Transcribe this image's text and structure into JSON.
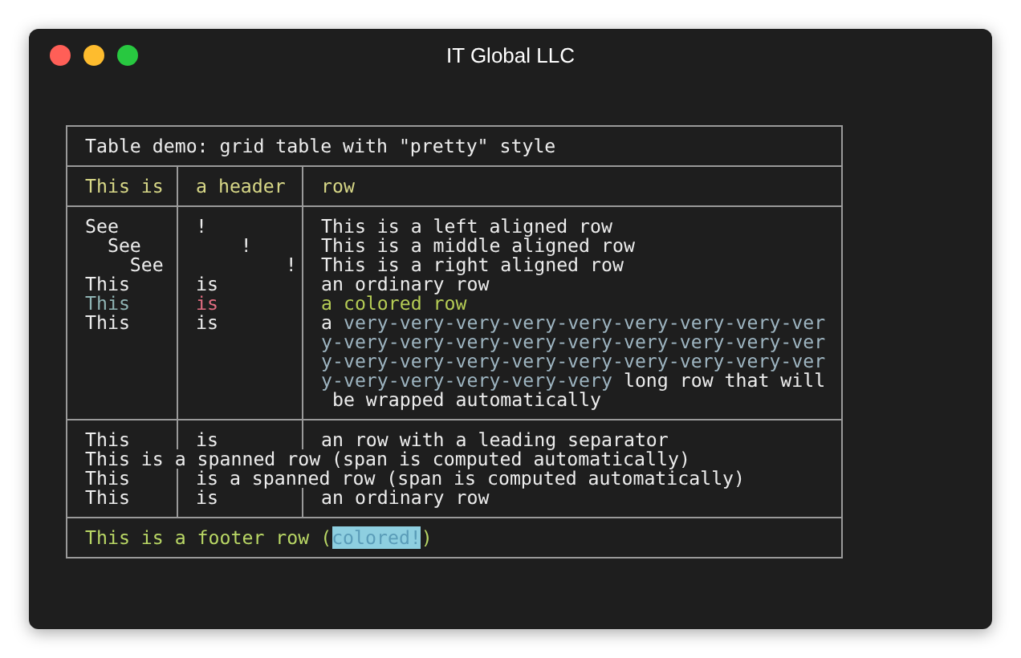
{
  "window": {
    "title": "IT Global LLC"
  },
  "table": {
    "caption": "Table demo: grid table with \"pretty\" style",
    "sections": [
      {
        "kind": "header",
        "rows": [
          {
            "cells": [
              {
                "lines": [
                  [
                    {
                      "text": "This is"
                    }
                  ]
                ]
              },
              {
                "lines": [
                  [
                    {
                      "text": "a header"
                    }
                  ]
                ]
              },
              {
                "lines": [
                  [
                    {
                      "text": "row"
                    }
                  ]
                ]
              }
            ]
          }
        ]
      },
      {
        "kind": "body",
        "rows": [
          {
            "cells": [
              {
                "lines": [
                  [
                    {
                      "text": "See"
                    }
                  ]
                ]
              },
              {
                "lines": [
                  [
                    {
                      "text": "!"
                    }
                  ]
                ]
              },
              {
                "lines": [
                  [
                    {
                      "text": "This is a left aligned row"
                    }
                  ]
                ]
              }
            ]
          },
          {
            "cells": [
              {
                "lines": [
                  [
                    {
                      "text": "  See"
                    }
                  ]
                ]
              },
              {
                "lines": [
                  [
                    {
                      "text": "    !"
                    }
                  ]
                ]
              },
              {
                "lines": [
                  [
                    {
                      "text": "This is a middle aligned row"
                    }
                  ]
                ]
              }
            ]
          },
          {
            "cells": [
              {
                "lines": [
                  [
                    {
                      "text": "    See"
                    }
                  ]
                ]
              },
              {
                "lines": [
                  [
                    {
                      "text": "        !"
                    }
                  ]
                ]
              },
              {
                "lines": [
                  [
                    {
                      "text": "This is a right aligned row"
                    }
                  ]
                ]
              }
            ]
          },
          {
            "cells": [
              {
                "lines": [
                  [
                    {
                      "text": "This"
                    }
                  ]
                ]
              },
              {
                "lines": [
                  [
                    {
                      "text": "is"
                    }
                  ]
                ]
              },
              {
                "lines": [
                  [
                    {
                      "text": "an ordinary row"
                    }
                  ]
                ]
              }
            ]
          },
          {
            "cells": [
              {
                "lines": [
                  [
                    {
                      "text": "This",
                      "color": "#8fb3b3"
                    }
                  ]
                ]
              },
              {
                "lines": [
                  [
                    {
                      "text": "is",
                      "color": "#e06c80"
                    }
                  ]
                ]
              },
              {
                "lines": [
                  [
                    {
                      "text": "a colored row",
                      "color": "#b5cc55"
                    }
                  ]
                ]
              }
            ]
          },
          {
            "cells": [
              {
                "lines": [
                  [
                    {
                      "text": "This"
                    }
                  ]
                ]
              },
              {
                "lines": [
                  [
                    {
                      "text": "is"
                    }
                  ]
                ]
              },
              {
                "lines": [
                  [
                    {
                      "text": "a "
                    },
                    {
                      "text": "very-very-very-very-very-very-very-very-ver",
                      "color": "#9db4c0"
                    }
                  ],
                  [
                    {
                      "text": "y-very-very-very-very-very-very-very-very-ver",
                      "color": "#9db4c0"
                    }
                  ],
                  [
                    {
                      "text": "y-very-very-very-very-very-very-very-very-ver",
                      "color": "#9db4c0"
                    }
                  ],
                  [
                    {
                      "text": "y-very-very-very-very-very",
                      "color": "#9db4c0"
                    },
                    {
                      "text": " long row that will"
                    }
                  ],
                  [
                    {
                      "text": " be wrapped automatically"
                    }
                  ]
                ]
              }
            ]
          }
        ]
      },
      {
        "kind": "body",
        "rows": [
          {
            "cells": [
              {
                "lines": [
                  [
                    {
                      "text": "This"
                    }
                  ]
                ]
              },
              {
                "lines": [
                  [
                    {
                      "text": "is"
                    }
                  ]
                ]
              },
              {
                "lines": [
                  [
                    {
                      "text": "an row with a leading separator"
                    }
                  ]
                ]
              }
            ]
          },
          {
            "cells": [
              {
                "lines": [
                  [
                    {
                      "text": "This is a spanned row (span is computed automatically)"
                    }
                  ]
                ]
              }
            ]
          },
          {
            "cells": [
              {
                "lines": [
                  [
                    {
                      "text": "This"
                    }
                  ]
                ]
              },
              {
                "lines": [
                  [
                    {
                      "text": "is a spanned row (span is computed automatically)"
                    }
                  ]
                ]
              }
            ]
          },
          {
            "cells": [
              {
                "lines": [
                  [
                    {
                      "text": "This"
                    }
                  ]
                ]
              },
              {
                "lines": [
                  [
                    {
                      "text": "is"
                    }
                  ]
                ]
              },
              {
                "lines": [
                  [
                    {
                      "text": "an ordinary row"
                    }
                  ]
                ]
              }
            ]
          }
        ]
      }
    ],
    "footer": [
      {
        "text": "This is a footer row (",
        "highlighted": false
      },
      {
        "text": "colored!",
        "highlighted": true
      },
      {
        "text": ")",
        "highlighted": false
      }
    ]
  }
}
